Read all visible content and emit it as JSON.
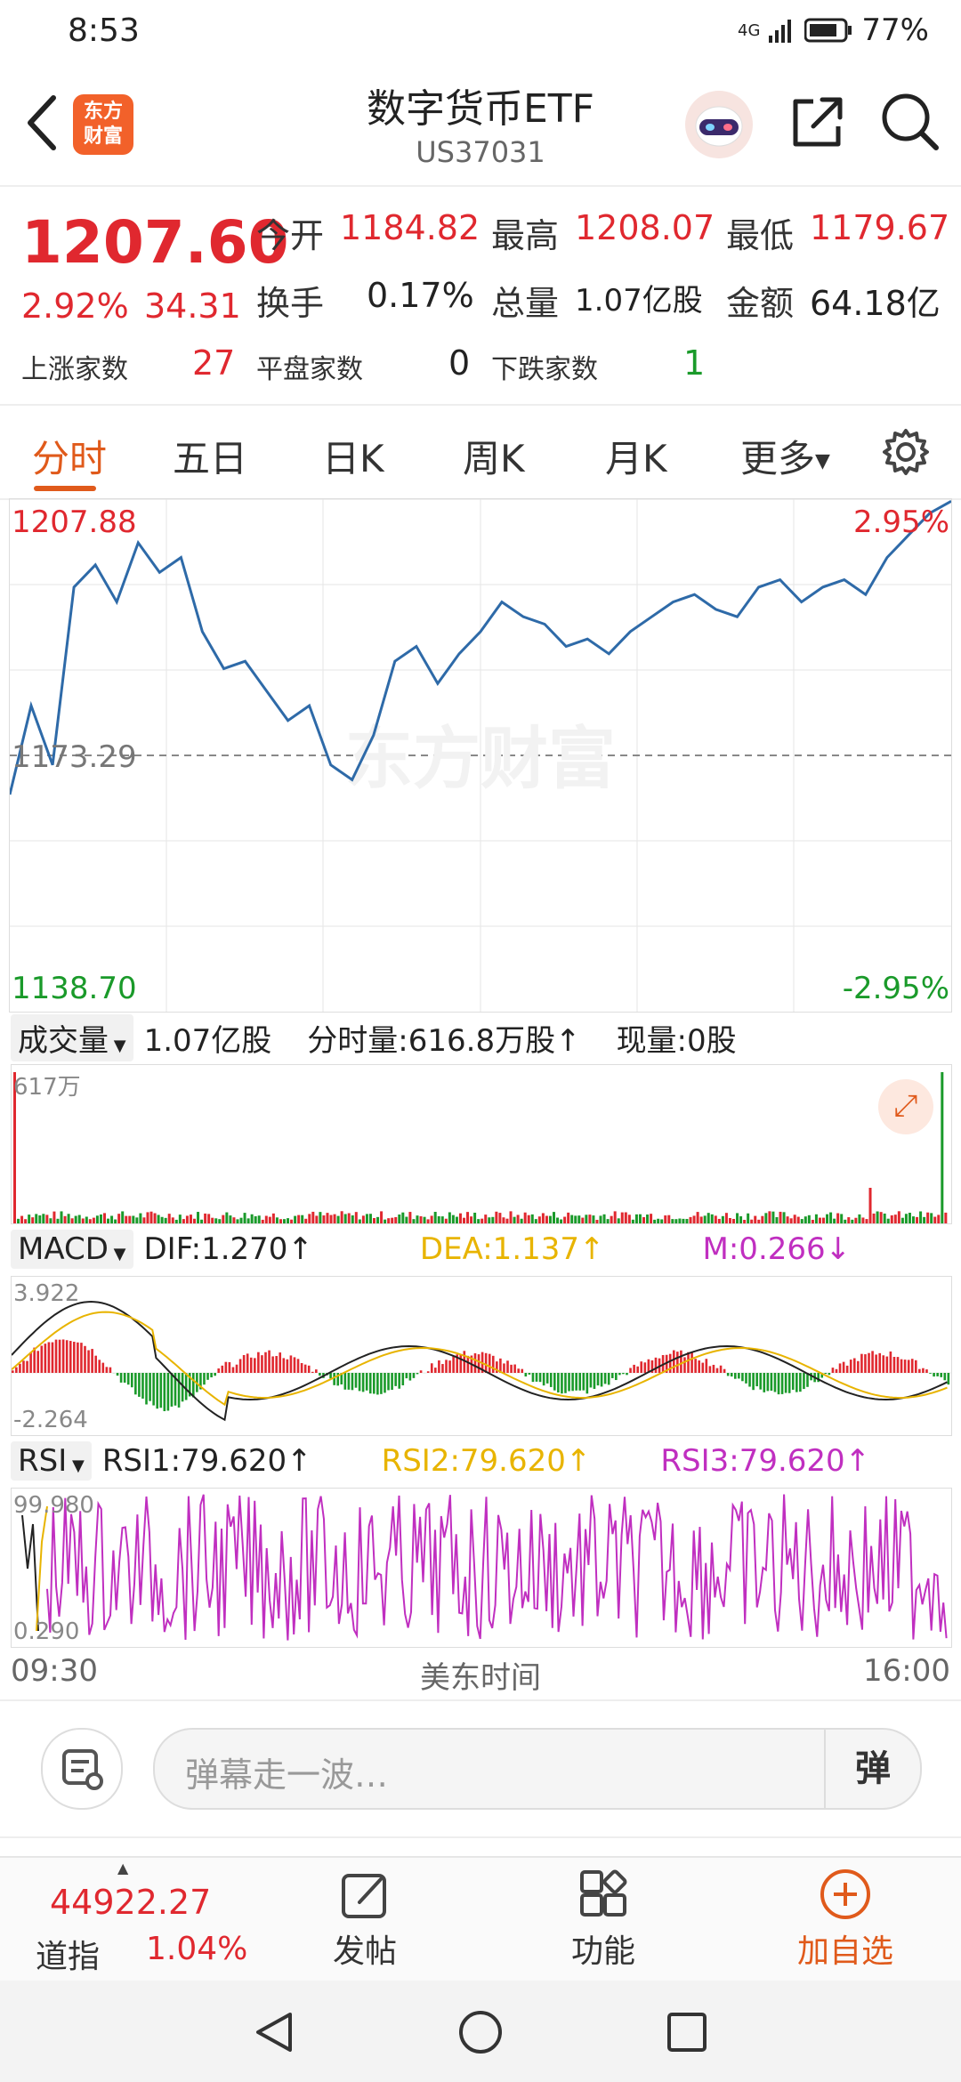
{
  "status": {
    "time": "8:53",
    "network": "4G",
    "battery": "77%"
  },
  "header": {
    "logo_line1": "东方",
    "logo_line2": "财富",
    "title": "数字货币ETF",
    "code": "US37031"
  },
  "quote": {
    "price": "1207.60",
    "change_pct": "2.92%",
    "change_amt": "34.31",
    "open_label": "今开",
    "open": "1184.82",
    "high_label": "最高",
    "high": "1208.07",
    "low_label": "最低",
    "low": "1179.67",
    "turnover_label": "换手",
    "turnover": "0.17%",
    "volume_label": "总量",
    "volume": "1.07亿股",
    "amount_label": "金额",
    "amount": "64.18亿",
    "up_label": "上涨家数",
    "up": "27",
    "flat_label": "平盘家数",
    "flat": "0",
    "down_label": "下跌家数",
    "down": "1"
  },
  "tabs": [
    "分时",
    "五日",
    "日K",
    "周K",
    "月K",
    "更多"
  ],
  "colors": {
    "accent": "#e05a1b",
    "up": "#e0282f",
    "down": "#1a9a2a",
    "line": "#2e6aa8",
    "dea": "#e8b400",
    "macd_m": "#c02fc0"
  },
  "chart_data": [
    {
      "type": "line",
      "title": "",
      "xlabel": "美东时间",
      "x_ticks": [
        "09:30",
        "16:00"
      ],
      "ylim": [
        1138.7,
        1207.88
      ],
      "y_labels": {
        "top": "1207.88",
        "mid": "1173.29",
        "bottom": "1138.70"
      },
      "pct_labels": {
        "top": "2.95%",
        "bottom": "-2.95%"
      },
      "series": [
        {
          "values": [
            1168,
            1180,
            1172,
            1196,
            1199,
            1194,
            1202,
            1198,
            1200,
            1190,
            1185,
            1186,
            1182,
            1178,
            1180,
            1172,
            1170,
            1176,
            1186,
            1188,
            1183,
            1187,
            1190,
            1194,
            1192,
            1191,
            1188,
            1189,
            1187,
            1190,
            1192,
            1194,
            1195,
            1193,
            1192,
            1196,
            1197,
            1194,
            1196,
            1197,
            1195,
            1200,
            1203,
            1206,
            1207.6
          ]
        }
      ]
    },
    {
      "type": "bar",
      "title": "成交量",
      "total": "1.07亿股",
      "minute_volume": "分时量:616.8万股↑",
      "current_volume": "现量:0股",
      "ymax_label": "617万"
    },
    {
      "type": "line",
      "title": "MACD",
      "dif_label": "DIF:1.270↑",
      "dea_label": "DEA:1.137↑",
      "m_label": "M:0.266↓",
      "ymax_label": "3.922",
      "ymin_label": "-2.264"
    },
    {
      "type": "line",
      "title": "RSI",
      "rsi1_label": "RSI1:79.620↑",
      "rsi2_label": "RSI2:79.620↑",
      "rsi3_label": "RSI3:79.620↑",
      "ymax_label": "99.980",
      "ymin_label": "0.290"
    }
  ],
  "watermark": "东方财富",
  "input": {
    "placeholder": "弹幕走一波…",
    "danmaku_button": "弹"
  },
  "bottom_nav": {
    "index_value": "44922.27",
    "index_name": "道指",
    "index_change": "1.04%",
    "post": "发帖",
    "function": "功能",
    "add_watch": "加自选"
  }
}
